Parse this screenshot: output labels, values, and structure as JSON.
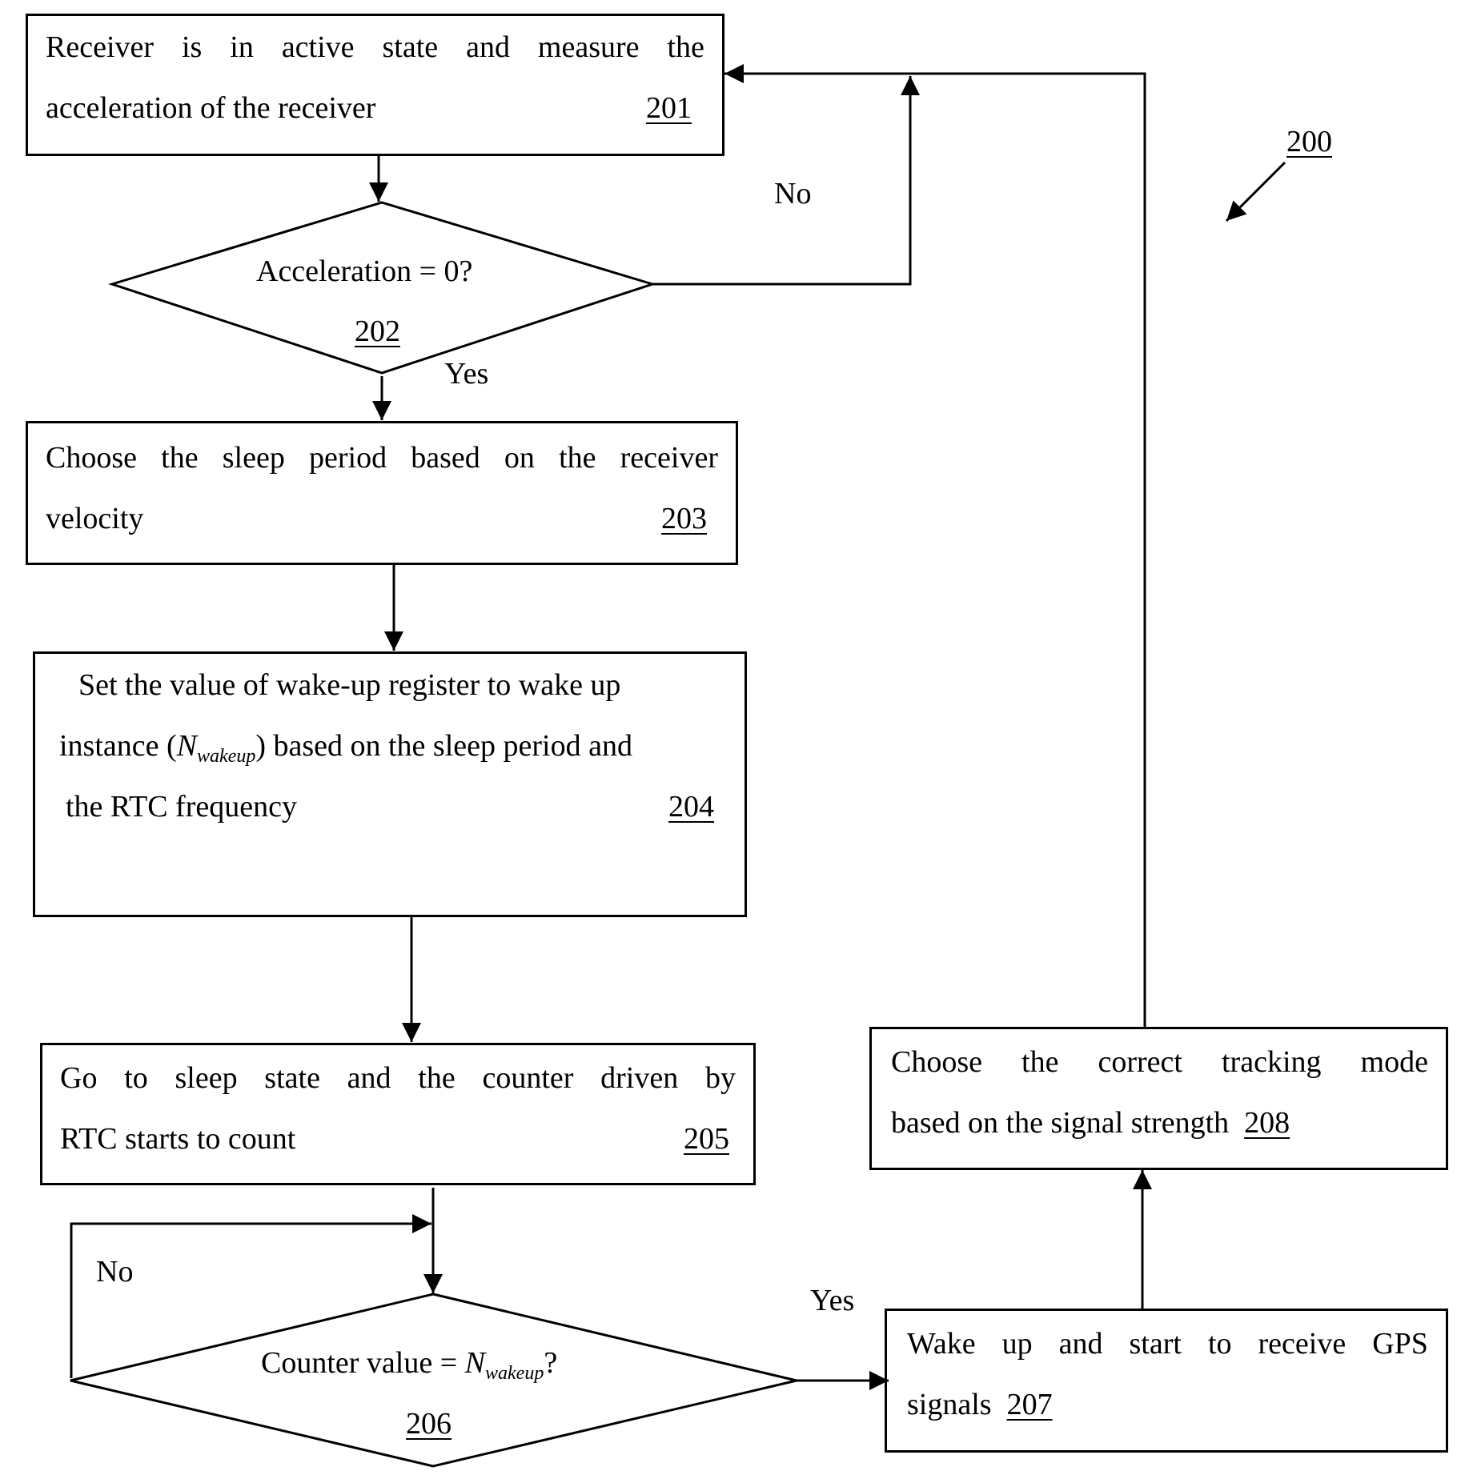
{
  "figure_ref": "200",
  "steps": {
    "s201": {
      "line1_words": [
        "Receiver",
        "is",
        "in",
        "active",
        "state",
        "and",
        "measure",
        "the"
      ],
      "line2": "acceleration of the receiver",
      "ref": "201"
    },
    "s202": {
      "question": "Acceleration = 0?",
      "ref": "202",
      "yes_label": "Yes",
      "no_label": "No"
    },
    "s203": {
      "line1_words": [
        "Choose",
        "the",
        "sleep",
        "period",
        "based",
        "on",
        "the",
        "receiver"
      ],
      "line2": "velocity",
      "ref": "203"
    },
    "s204": {
      "line1": "Set the value of wake-up register to wake up",
      "line2_pre": "instance (",
      "line2_var": "N",
      "line2_sub": "wakeup",
      "line2_post": ") based on the sleep period and",
      "line3": "the RTC frequency",
      "ref": "204"
    },
    "s205": {
      "line1_words": [
        "Go",
        "to",
        "sleep",
        "state",
        "and",
        "the",
        "counter",
        "driven",
        "by"
      ],
      "line2": "RTC starts to count",
      "ref": "205"
    },
    "s206": {
      "question_pre": "Counter value = ",
      "question_var": "N",
      "question_sub": "wakeup",
      "question_post": "?",
      "ref": "206",
      "yes_label": "Yes",
      "no_label": "No"
    },
    "s207": {
      "line1_words": [
        "Wake",
        "up",
        "and",
        "start",
        "to",
        "receive",
        "GPS"
      ],
      "line2": "signals",
      "ref": "207"
    },
    "s208": {
      "line1_words": [
        "Choose",
        "the",
        "correct",
        "tracking",
        "mode"
      ],
      "line2": "based on the signal strength",
      "ref": "208"
    }
  }
}
